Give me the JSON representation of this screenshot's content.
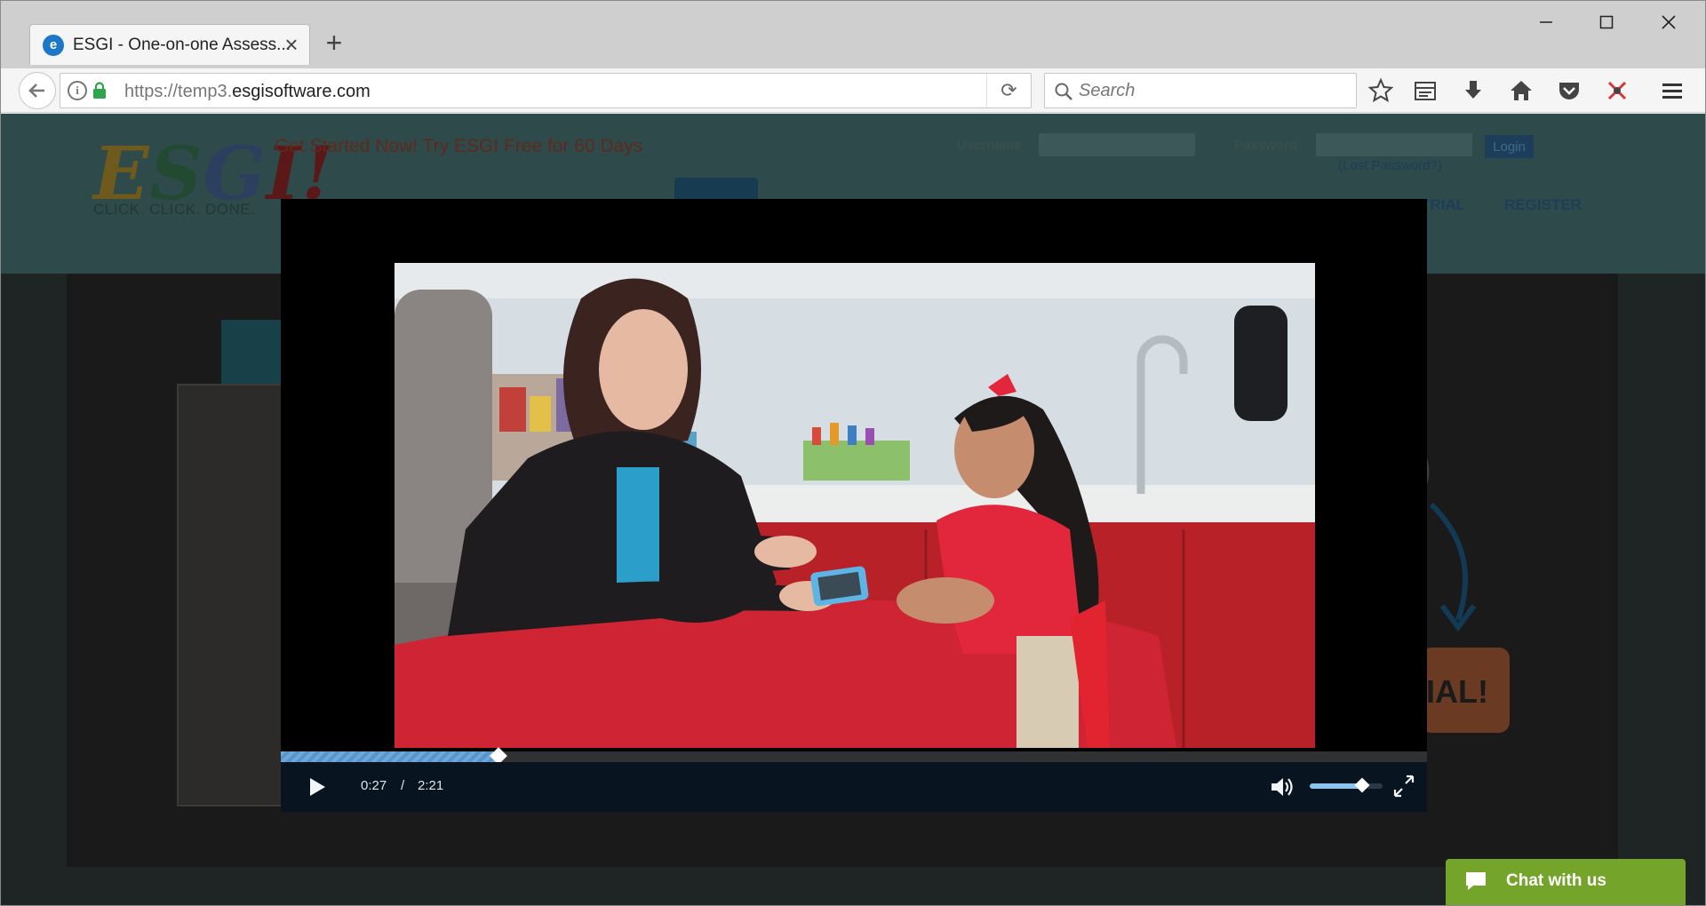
{
  "browser": {
    "tab": {
      "title": "ESGI - One-on-one Assess...",
      "favicon": "firefox-tab-favicon"
    },
    "url": {
      "prefix": "https://temp3.",
      "domain": "esgisoftware.com"
    },
    "search": {
      "placeholder": "Search"
    },
    "window_controls": [
      "minimize",
      "maximize",
      "close"
    ],
    "toolbar_icons": [
      "bookmark-star-icon",
      "reading-list-icon",
      "download-icon",
      "home-icon",
      "pocket-icon",
      "extension-icon",
      "menu-icon"
    ]
  },
  "site": {
    "logo_letters": [
      "E",
      "S",
      "G",
      "I"
    ],
    "logo_exclaim": "!",
    "tagline": "CLICK. CLICK. DONE.",
    "promo": "Get Started Now! Try ESGI Free for 60 Days",
    "login": {
      "username_label": "Username",
      "password_label": "Password",
      "button": "Login",
      "lost_password": "(Lost Password?)"
    },
    "nav": {
      "trial": "TRIAL",
      "register": "REGISTER"
    },
    "background_cta": "IAL!",
    "background_paren": ")"
  },
  "video": {
    "current_time": "0:27",
    "separator": "/",
    "duration": "2:21",
    "progress_fraction": 0.19,
    "volume_fraction": 0.72
  },
  "chat": {
    "label": "Chat with us"
  },
  "colors": {
    "progress": "#6fa9dc",
    "chat": "#74a52a",
    "overlay": "#1f2424"
  }
}
